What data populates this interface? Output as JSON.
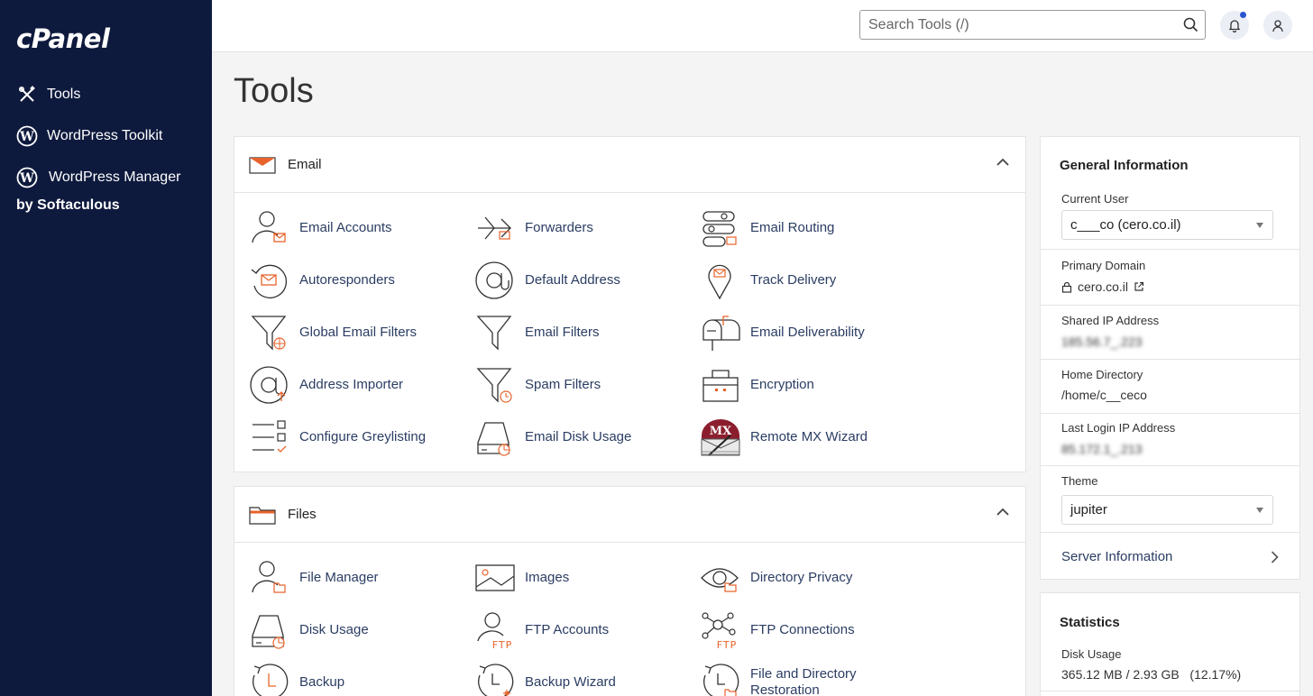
{
  "brand": {
    "logo": "cPanel"
  },
  "sidebar": {
    "items": [
      {
        "label": "Tools",
        "icon": "tools-icon"
      },
      {
        "label": "WordPress Toolkit",
        "icon": "wordpress-icon"
      },
      {
        "label": "WordPress Manager",
        "icon": "wordpress-icon"
      }
    ],
    "sub_label": "by Softaculous"
  },
  "topbar": {
    "search_placeholder": "Search Tools (/)"
  },
  "page": {
    "title": "Tools"
  },
  "email_section": {
    "title": "Email",
    "tools": [
      "Email Accounts",
      "Forwarders",
      "Email Routing",
      "Autoresponders",
      "Default Address",
      "Track Delivery",
      "Global Email Filters",
      "Email Filters",
      "Email Deliverability",
      "Address Importer",
      "Spam Filters",
      "Encryption",
      "Configure Greylisting",
      "Email Disk Usage",
      "Remote MX Wizard"
    ]
  },
  "files_section": {
    "title": "Files",
    "tools": [
      "File Manager",
      "Images",
      "Directory Privacy",
      "Disk Usage",
      "FTP Accounts",
      "FTP Connections",
      "Backup",
      "Backup Wizard",
      "File and Directory Restoration"
    ]
  },
  "general_info": {
    "title": "General Information",
    "current_user_label": "Current User",
    "current_user_value": "c___co (cero.co.il)",
    "primary_domain_label": "Primary Domain",
    "primary_domain_value": "cero.co.il",
    "shared_ip_label": "Shared IP Address",
    "shared_ip_value": "185.56.7_.223",
    "home_dir_label": "Home Directory",
    "home_dir_value": "/home/c__ceco",
    "last_login_label": "Last Login IP Address",
    "last_login_value": "85.172.1_.213",
    "theme_label": "Theme",
    "theme_value": "jupiter",
    "server_info_label": "Server Information"
  },
  "statistics": {
    "title": "Statistics",
    "disk_usage_label": "Disk Usage",
    "disk_usage_value": "365.12 MB / 2.93 GB   (12.17%)"
  },
  "colors": {
    "sidebar_bg": "#0e1a3d",
    "accent_orange": "#e8632b",
    "link_blue": "#2b3d63"
  }
}
